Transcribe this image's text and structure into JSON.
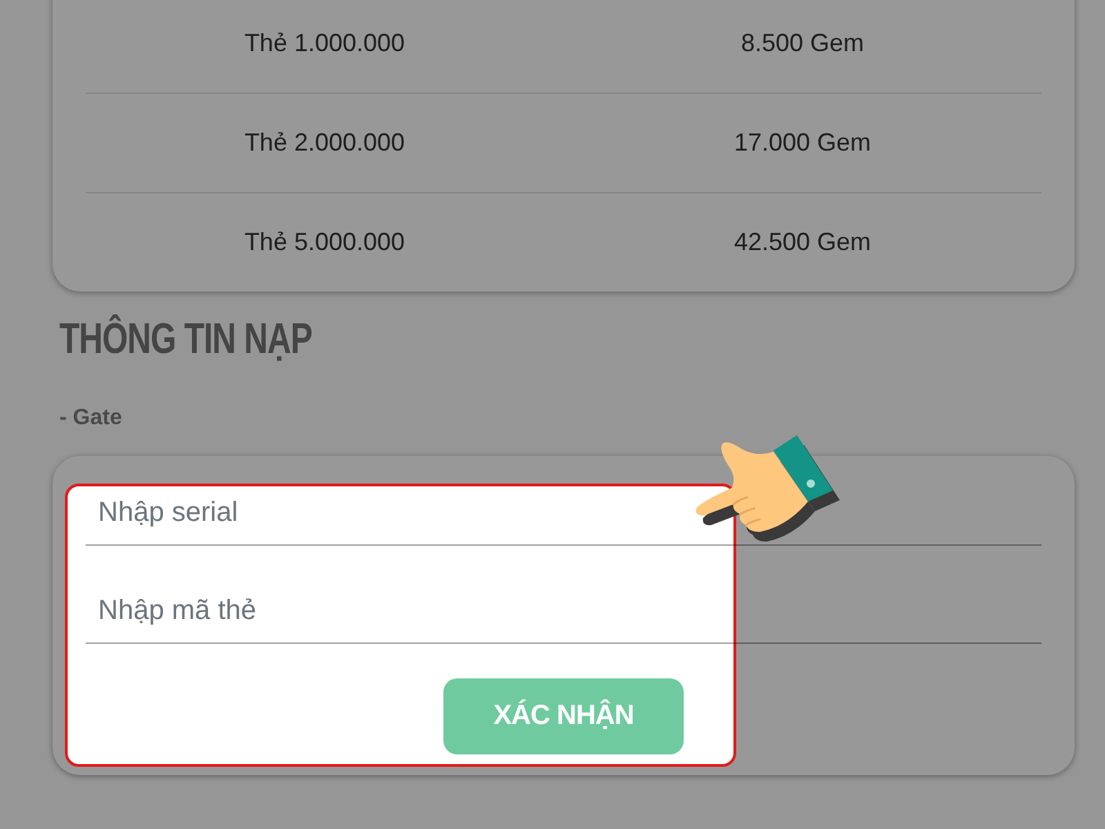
{
  "rate_table": {
    "rows": [
      {
        "cells": [
          "Thẻ 1.000.000",
          "8.500 Gem"
        ]
      },
      {
        "cells": [
          "Thẻ 2.000.000",
          "17.000 Gem"
        ]
      },
      {
        "cells": [
          "Thẻ 5.000.000",
          "42.500 Gem"
        ]
      }
    ]
  },
  "section_title": "THÔNG TIN NẠP",
  "gate_label": "- Gate",
  "form": {
    "fields": [
      {
        "placeholder": "Nhập serial"
      },
      {
        "placeholder": "Nhập mã thẻ"
      }
    ],
    "submit_button": "XÁC NHẬN"
  }
}
